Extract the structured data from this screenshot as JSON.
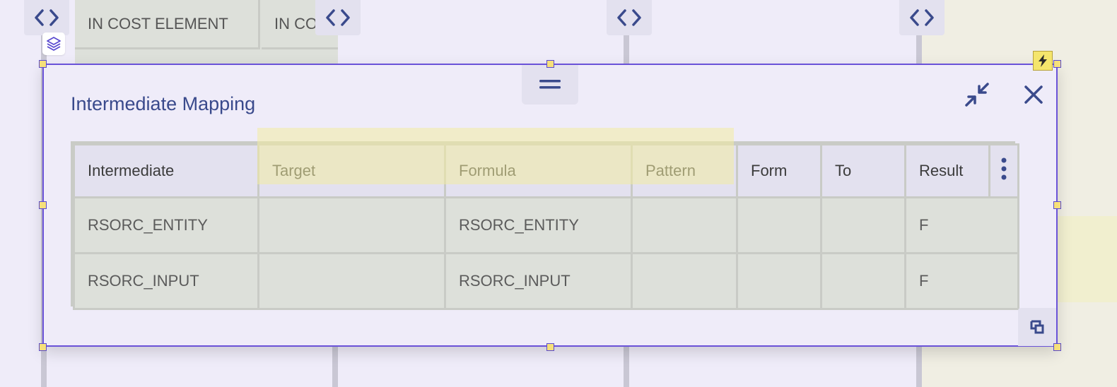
{
  "background": {
    "column_header_labels": [
      "IN COST ELEMENT",
      "IN CO"
    ]
  },
  "dialog": {
    "title": "Intermediate Mapping",
    "columns": [
      "Intermediate",
      "Target",
      "Formula",
      "Pattern",
      "Form",
      "To",
      "Result"
    ],
    "rows": [
      [
        "RSORC_ENTITY",
        "",
        "RSORC_ENTITY",
        "",
        "",
        "",
        "F"
      ],
      [
        "RSORC_INPUT",
        "",
        "RSORC_INPUT",
        "",
        "",
        "",
        "F"
      ]
    ],
    "buttons": {
      "collapse_icon": "collapse-arrows-icon",
      "close_icon": "close-icon",
      "resize_icon": "resize-corner-icon",
      "menu_icon": "vertical-dots-icon",
      "drag_icon": "drag-handle-icon"
    }
  },
  "colors": {
    "accent": "#3a4a8c",
    "selection_border": "#6a52d8",
    "highlight": "#f2eda2",
    "handle": "#f6e07a"
  }
}
